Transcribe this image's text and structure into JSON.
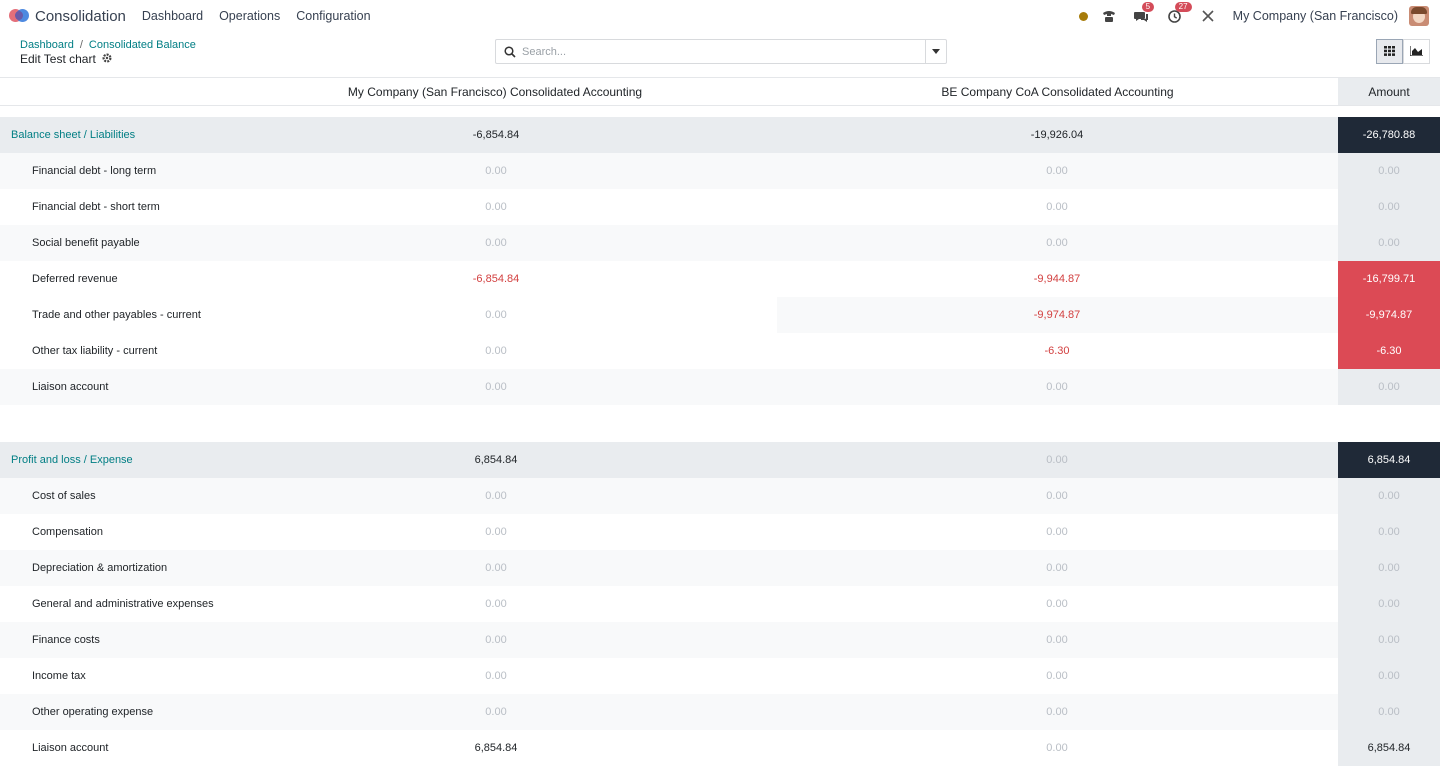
{
  "app": {
    "name": "Consolidation"
  },
  "menu": [
    "Dashboard",
    "Operations",
    "Configuration"
  ],
  "systray": {
    "chat_count": "5",
    "activity_count": "27",
    "company": "My Company (San Francisco)"
  },
  "breadcrumb": {
    "root": "Dashboard",
    "current": "Consolidated Balance"
  },
  "subtitle": "Edit Test chart",
  "search": {
    "placeholder": "Search..."
  },
  "columns": {
    "col_a": "My Company (San Francisco) Consolidated Accounting",
    "col_b": "BE Company CoA Consolidated Accounting",
    "amount": "Amount"
  },
  "rows": [
    {
      "label": "Balance sheet / Liabilities",
      "a": "-6,854.84",
      "b": "-19,926.04",
      "amount": "-26,780.88"
    },
    {
      "label": "Financial debt - long term",
      "a": "0.00",
      "b": "0.00",
      "amount": "0.00"
    },
    {
      "label": "Financial debt - short term",
      "a": "0.00",
      "b": "0.00",
      "amount": "0.00"
    },
    {
      "label": "Social benefit payable",
      "a": "0.00",
      "b": "0.00",
      "amount": "0.00"
    },
    {
      "label": "Deferred revenue",
      "a": "-6,854.84",
      "b": "-9,944.87",
      "amount": "-16,799.71"
    },
    {
      "label": "Trade and other payables - current",
      "a": "0.00",
      "b": "-9,974.87",
      "amount": "-9,974.87"
    },
    {
      "label": "Other tax liability - current",
      "a": "0.00",
      "b": "-6.30",
      "amount": "-6.30"
    },
    {
      "label": "Liaison account",
      "a": "0.00",
      "b": "0.00",
      "amount": "0.00"
    },
    {
      "label": "Profit and loss / Expense",
      "a": "6,854.84",
      "b": "0.00",
      "amount": "6,854.84"
    },
    {
      "label": "Cost of sales",
      "a": "0.00",
      "b": "0.00",
      "amount": "0.00"
    },
    {
      "label": "Compensation",
      "a": "0.00",
      "b": "0.00",
      "amount": "0.00"
    },
    {
      "label": "Depreciation & amortization",
      "a": "0.00",
      "b": "0.00",
      "amount": "0.00"
    },
    {
      "label": "General and administrative expenses",
      "a": "0.00",
      "b": "0.00",
      "amount": "0.00"
    },
    {
      "label": "Finance costs",
      "a": "0.00",
      "b": "0.00",
      "amount": "0.00"
    },
    {
      "label": "Income tax",
      "a": "0.00",
      "b": "0.00",
      "amount": "0.00"
    },
    {
      "label": "Other operating expense",
      "a": "0.00",
      "b": "0.00",
      "amount": "0.00"
    },
    {
      "label": "Liaison account",
      "a": "6,854.84",
      "b": "0.00",
      "amount": "6,854.84"
    }
  ],
  "colors": {
    "accent": "#017e84",
    "negative_text": "#d23f3f",
    "negative_cell_bg": "#dc4a55",
    "group_amount_bg": "#1f2937",
    "group_row_bg": "#e9ecef",
    "alt_row_bg": "#f8f9fa"
  }
}
